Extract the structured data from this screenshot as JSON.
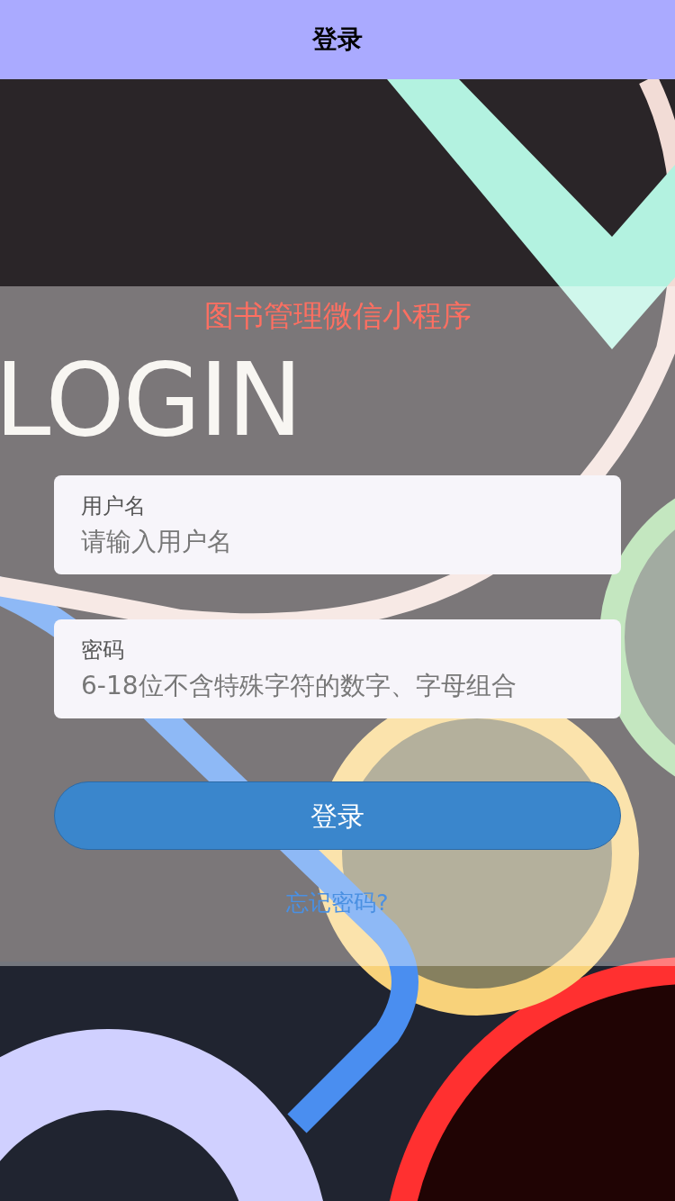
{
  "header": {
    "title": "登录"
  },
  "app_name": "图书管理微信小程序",
  "heading": "LOGIN",
  "fields": [
    {
      "label": "用户名",
      "placeholder": "请输入用户名"
    },
    {
      "label": "密码",
      "placeholder": "6-18位不含特殊字符的数字、字母组合"
    }
  ],
  "login_button": "登录",
  "forgot_link": "忘记密码?"
}
